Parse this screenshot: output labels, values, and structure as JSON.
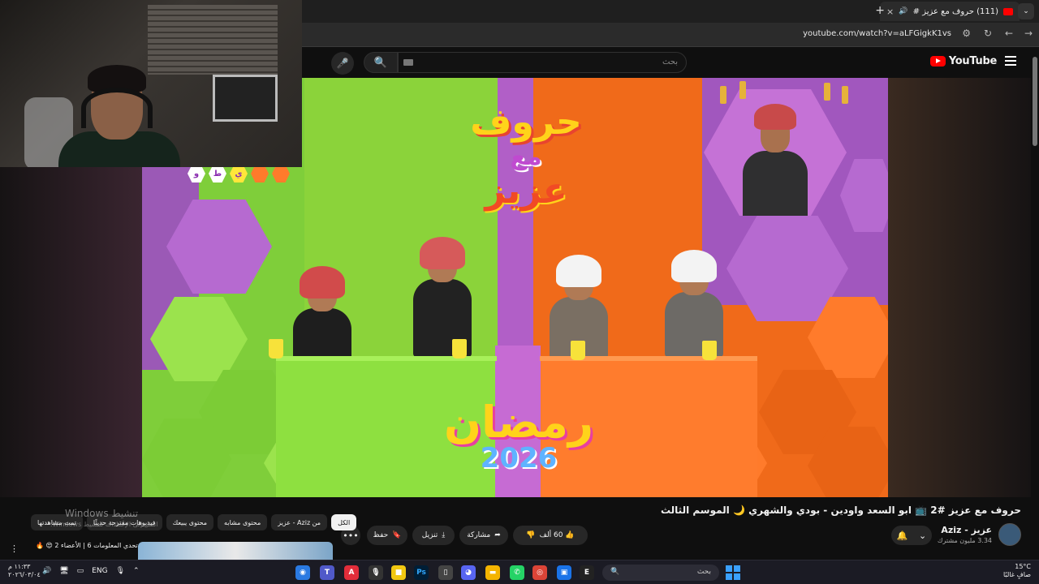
{
  "browser": {
    "tab_title": "(111) حروف مع عزيز #2 📺",
    "new_tab_symbol": "+",
    "close_symbol": "×",
    "url": "youtube.com/watch?v=aLFGigkK1vs"
  },
  "youtube": {
    "logo_text": "YouTube",
    "search_placeholder": "بحث",
    "video": {
      "title": "حروف مع عزيز #2 📺 ابو السعد واودين - بودي والشهري 🌙 الموسم الثالث",
      "channel": "عزيز - Aziz",
      "subscribers": "3.34 مليون مشترك",
      "likes": "60 ألف",
      "actions": {
        "share": "مشاركة",
        "download": "تنزيل",
        "save": "حفظ"
      }
    },
    "overlay_text": {
      "show_title_l1": "حروف",
      "show_title_l2": "مع",
      "show_title_l3": "عزيز",
      "ramadan_word": "رمضان",
      "ramadan_year": "2026",
      "letters": [
        "و",
        "ط",
        "ي"
      ]
    },
    "chips": [
      "الكل",
      "من Aziz - عزيز",
      "محتوى مشابه",
      "محتوى يبيعك",
      "فيديوهات مقترحة حديثًا",
      "تمت مشاهدتها"
    ],
    "recommendation_title": "تحدي المعلومات 6 | الأعضاء 2 😍 🔥",
    "activate_title": "تنشيط Windows",
    "activate_sub": "انتقل إلى الإعدادات لتنشيط Windows."
  },
  "taskbar": {
    "search_placeholder": "بحث",
    "weather_temp": "15°C",
    "weather_desc": "صافٍ غالبًا",
    "time": "١١:٣٣ م",
    "date": "٢٠٢٦/٠٣/٠٤",
    "lang": "ENG"
  },
  "colors": {
    "yt_red": "#ff0000",
    "bg": "#0f0f0f",
    "stage_green": "#8bd33a",
    "stage_orange": "#f06a1a",
    "stage_purple": "#b15fc7"
  }
}
